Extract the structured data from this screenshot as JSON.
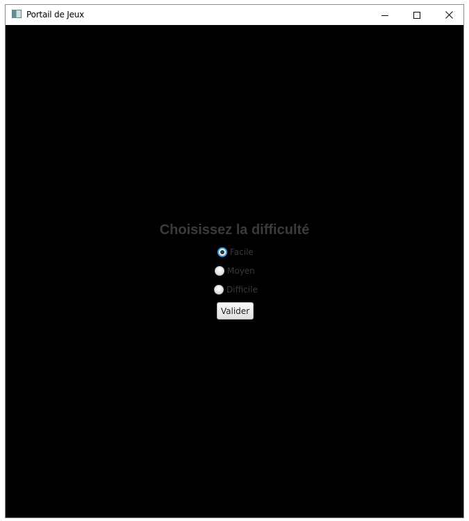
{
  "window": {
    "title": "Portail de Jeux",
    "icon": "java-app-icon",
    "controls": {
      "minimize_icon": "minimize-icon",
      "maximize_icon": "maximize-icon",
      "close_icon": "close-icon"
    }
  },
  "content": {
    "background_color": "#000000",
    "heading": "Choisissez la difficulté",
    "difficulty_options": [
      {
        "label": "Facile",
        "selected": true
      },
      {
        "label": "Moyen",
        "selected": false
      },
      {
        "label": "Difficile",
        "selected": false
      }
    ],
    "submit_label": "Valider"
  },
  "colors": {
    "heading": "#3b3b3b",
    "radio_focus": "#39a0e6",
    "label": "#3a3a3a"
  }
}
